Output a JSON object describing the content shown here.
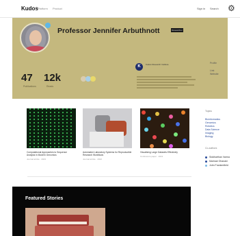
{
  "nav": {
    "logo": "Kudos",
    "links": [
      "Platform",
      "Product"
    ],
    "right_links": [
      "Sign in",
      "Search"
    ],
    "settings_icon": "gear-icon"
  },
  "profile": {
    "name": "Professor Jennifer Arbuthnott",
    "tag": "Researcher",
    "avatar_icon": "avatar",
    "verified_badge_icon": "verified-badge-icon",
    "stats": [
      {
        "value": "47",
        "label": "Publications"
      },
      {
        "value": "12k",
        "label": "Reads"
      }
    ],
    "metric_dots_colors": [
      "#d9ccb0",
      "#a8d0e8",
      "#e9d96a"
    ],
    "affiliation": {
      "icon_text": "K",
      "title": "Kudos Research Institute"
    },
    "side_labels": [
      "Profile",
      "Link",
      "Website"
    ]
  },
  "publications": [
    {
      "title": "Computational Approaches to Sequence Analysis in Modern Genomics",
      "meta": "Journal article · 2023"
    },
    {
      "title": "Automated Laboratory Systems for Reproducible Research Workflows",
      "meta": "Journal article · 2022"
    },
    {
      "title": "Visualising Large Datasets Effectively",
      "meta": "Conference paper · 2021"
    }
  ],
  "sidebar": {
    "heading": "Topics",
    "topics": [
      "Bioinformatics",
      "Genomics",
      "Robotics",
      "Data Science",
      "Imaging",
      "Biology"
    ],
    "people_heading": "Co-authors",
    "people": [
      {
        "name": "Siddharthan Varma",
        "color": "#2a4c9b"
      },
      {
        "name": "Marinae Ohanaki",
        "color": "#2a4c9b"
      },
      {
        "name": "John Frankenfield",
        "color": "#79b9e6"
      }
    ]
  },
  "featured": {
    "title": "Featured Stories"
  }
}
